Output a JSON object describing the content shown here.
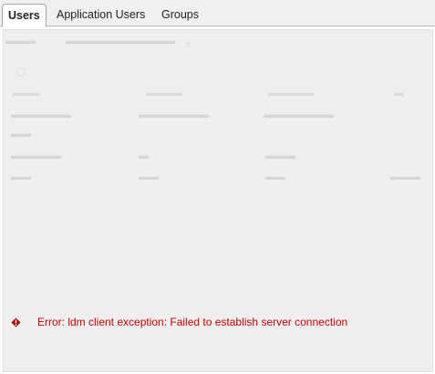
{
  "tabs": [
    {
      "label": "Users",
      "active": true
    },
    {
      "label": "Application Users",
      "active": false
    },
    {
      "label": "Groups",
      "active": false
    }
  ],
  "error": {
    "icon": "error-icon",
    "text": "Error: ldm client exception: Failed to establish server connection",
    "color": "#c00000"
  },
  "colors": {
    "tab_bar": "#f0f0f0",
    "panel": "#efefef",
    "error_text": "#c00000"
  }
}
